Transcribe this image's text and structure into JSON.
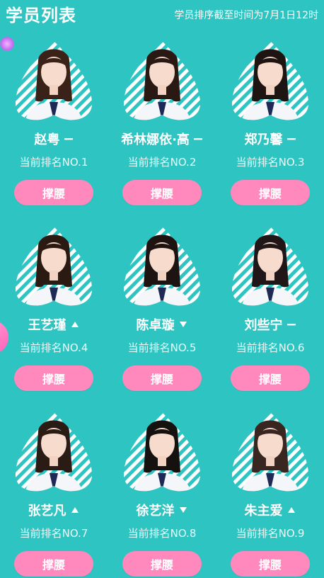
{
  "header": {
    "title": "学员列表",
    "update_note": "学员排序截至时间为7月1日12时"
  },
  "colors": {
    "background": "#2ec4c1",
    "button": "#ff88bd",
    "text": "#ffffff"
  },
  "trainees": [
    {
      "name": "赵粤",
      "trend": "flat",
      "rank_text": "当前排名NO.1",
      "button": "撑腰"
    },
    {
      "name": "希林娜依·高",
      "trend": "flat",
      "rank_text": "当前排名NO.2",
      "button": "撑腰"
    },
    {
      "name": "郑乃馨",
      "trend": "flat",
      "rank_text": "当前排名NO.3",
      "button": "撑腰"
    },
    {
      "name": "王艺瑾",
      "trend": "up",
      "rank_text": "当前排名NO.4",
      "button": "撑腰"
    },
    {
      "name": "陈卓璇",
      "trend": "down",
      "rank_text": "当前排名NO.5",
      "button": "撑腰"
    },
    {
      "name": "刘些宁",
      "trend": "flat",
      "rank_text": "当前排名NO.6",
      "button": "撑腰"
    },
    {
      "name": "张艺凡",
      "trend": "up",
      "rank_text": "当前排名NO.7",
      "button": "撑腰"
    },
    {
      "name": "徐艺洋",
      "trend": "down",
      "rank_text": "当前排名NO.8",
      "button": "撑腰"
    },
    {
      "name": "朱主爱",
      "trend": "up",
      "rank_text": "当前排名NO.9",
      "button": "撑腰"
    }
  ]
}
